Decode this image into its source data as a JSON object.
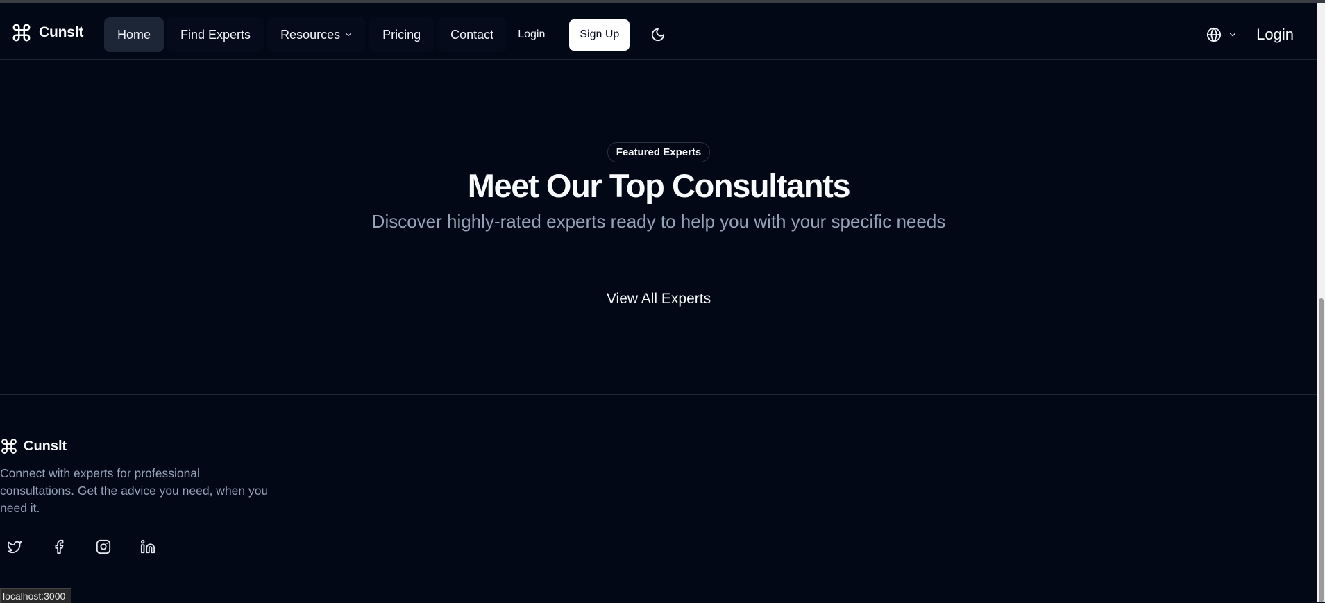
{
  "app": {
    "brand": "Cunslt"
  },
  "nav": {
    "home": "Home",
    "find_experts": "Find Experts",
    "resources": "Resources",
    "pricing": "Pricing",
    "contact": "Contact",
    "login": "Login",
    "signup": "Sign Up"
  },
  "header_right": {
    "login": "Login"
  },
  "featured": {
    "badge": "Featured Experts",
    "title": "Meet Our Top Consultants",
    "subtitle": "Discover highly-rated experts ready to help you with your specific needs",
    "view_all": "View All Experts"
  },
  "footer": {
    "brand": "Cunslt",
    "description": "Connect with experts for professional consultations. Get the advice you need, when you need it.",
    "socials": [
      "twitter-icon",
      "facebook-icon",
      "instagram-icon",
      "linkedin-icon"
    ]
  },
  "status_bar": {
    "url": "localhost:3000"
  },
  "colors": {
    "background": "#030816",
    "nav_active": "#1c2637",
    "muted_text": "#94a3b8",
    "border": "#1e2533"
  }
}
